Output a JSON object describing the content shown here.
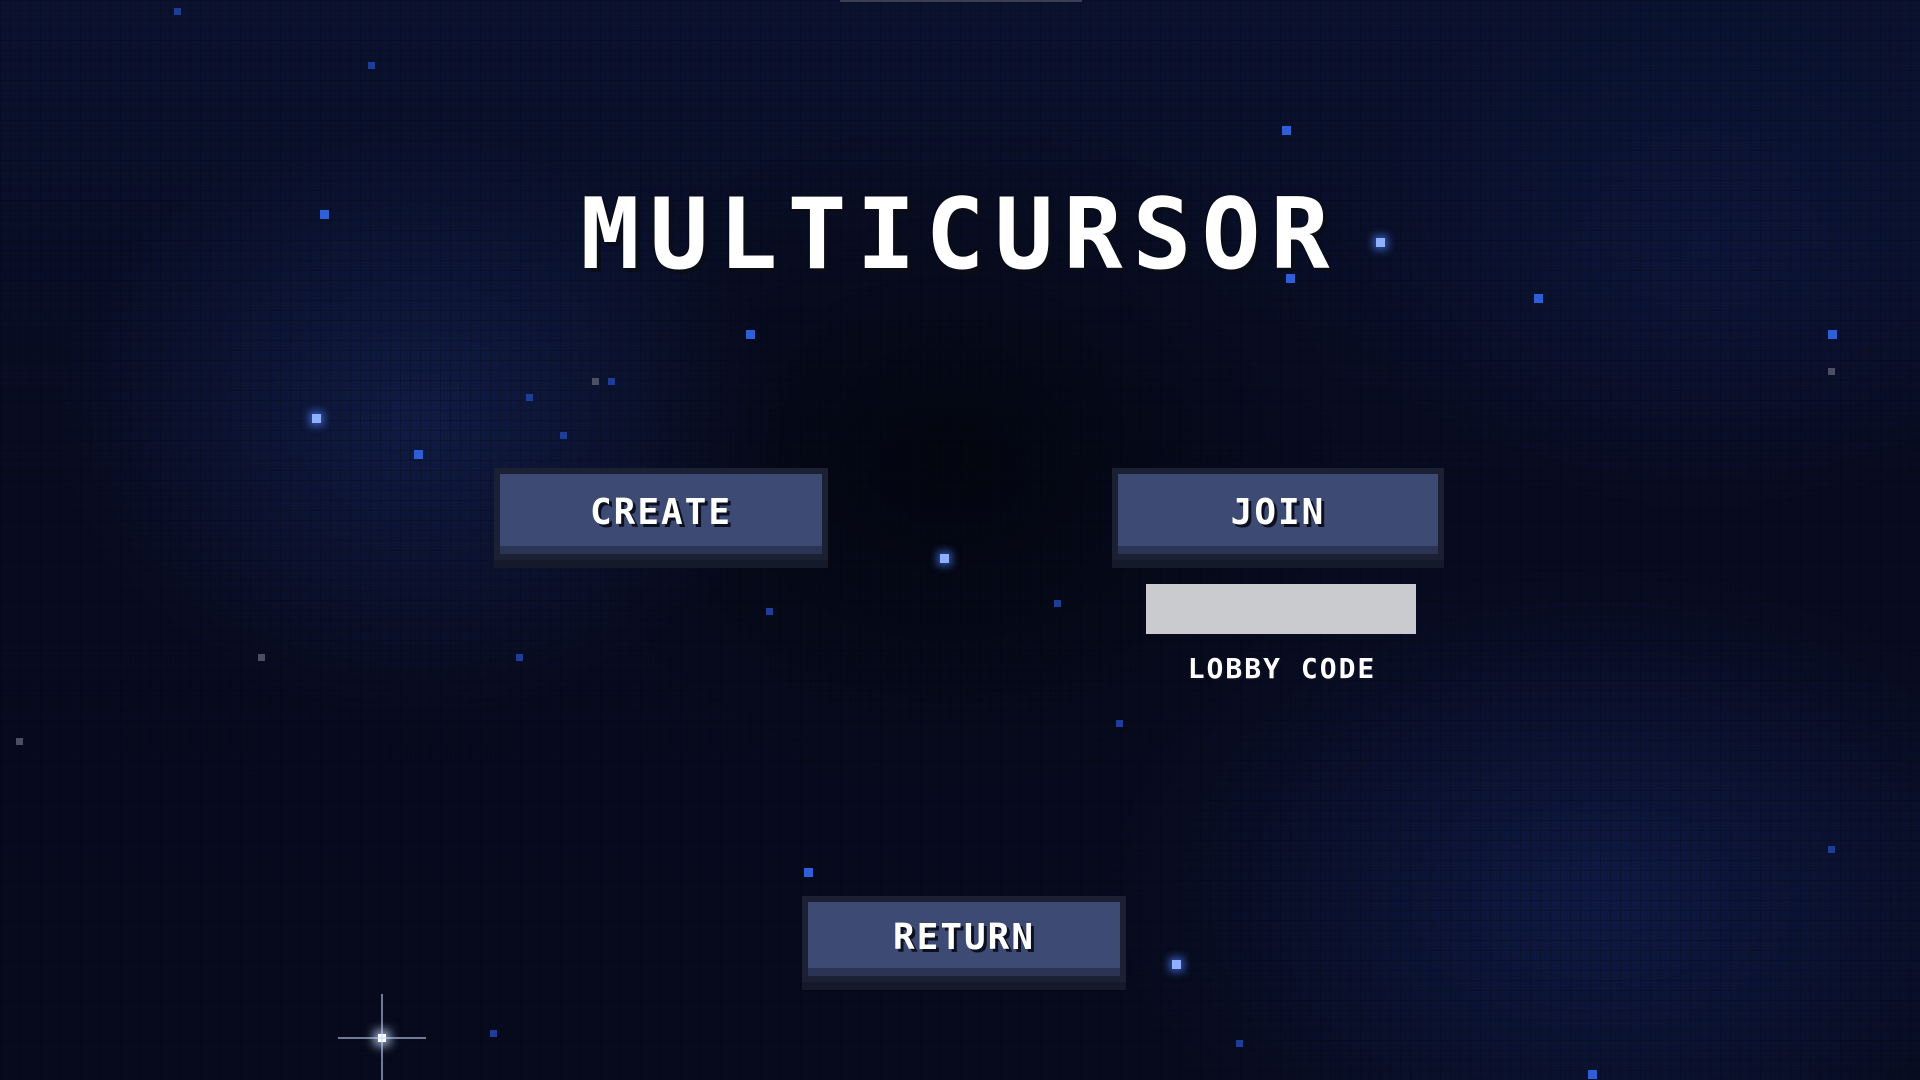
{
  "game": {
    "title": "MULTICURSOR"
  },
  "menu": {
    "create_label": "CREATE",
    "join_label": "JOIN",
    "return_label": "RETURN"
  },
  "lobby": {
    "code_value": "",
    "code_label": "LOBBY CODE"
  },
  "colors": {
    "background": "#070b20",
    "button_fill": "#3d4a73",
    "button_border": "#1b2033",
    "input_fill": "#cacbcf",
    "text": "#ffffff",
    "star_blue": "#2f5fd6"
  }
}
